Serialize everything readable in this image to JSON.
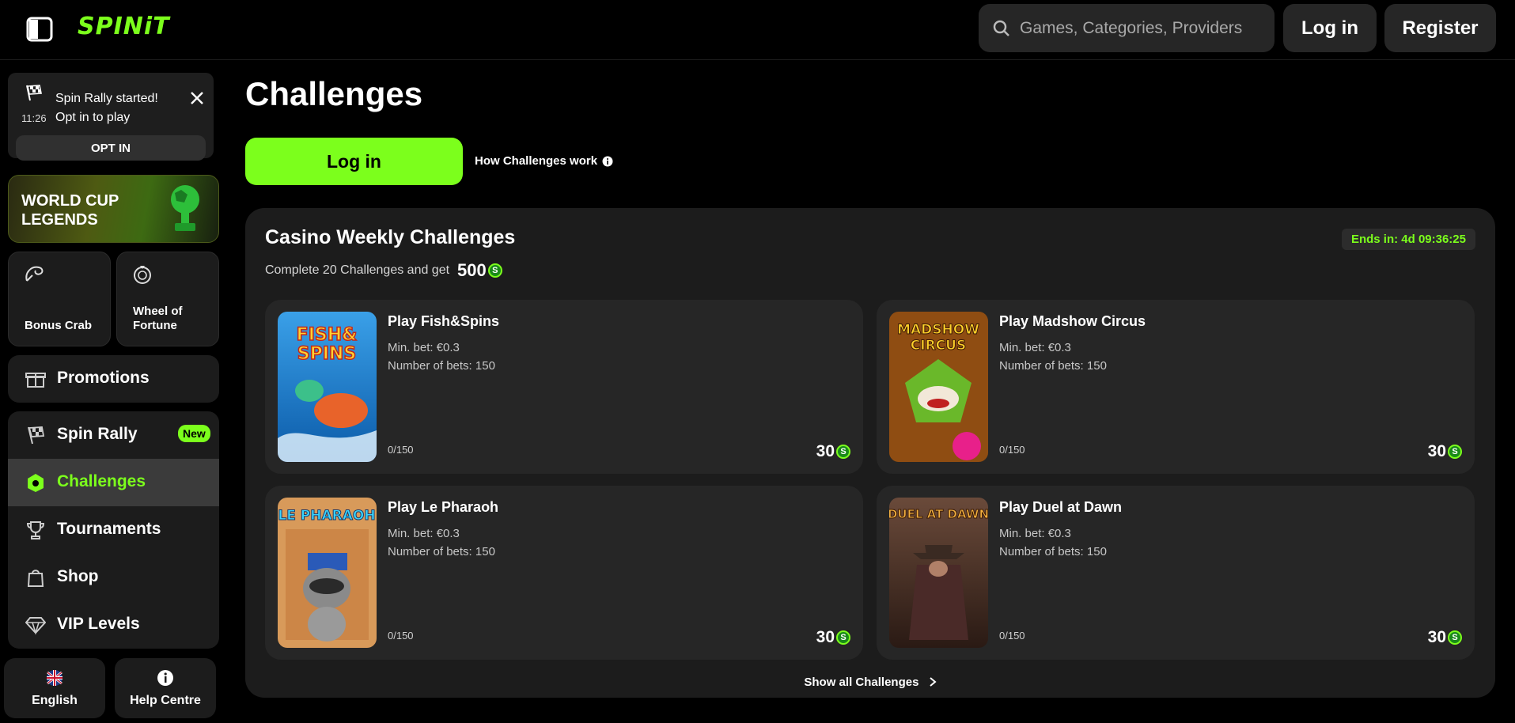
{
  "header": {
    "logo": "SPINiT",
    "search_placeholder": "Games, Categories, Providers",
    "login_label": "Log in",
    "register_label": "Register"
  },
  "sidebar": {
    "notice": {
      "time": "11:26",
      "title": "Spin Rally started!",
      "subtitle": "Opt in to play",
      "optin_label": "OPT IN"
    },
    "world_cup": "WORLD CUP LEGENDS",
    "tiles": [
      {
        "label": "Bonus Crab"
      },
      {
        "label": "Wheel of Fortune"
      }
    ],
    "promotions": "Promotions",
    "nav": [
      {
        "label": "Spin Rally",
        "badge": "New"
      },
      {
        "label": "Challenges"
      },
      {
        "label": "Tournaments"
      },
      {
        "label": "Shop"
      },
      {
        "label": "VIP Levels"
      }
    ],
    "language": "English",
    "help": "Help Centre"
  },
  "main": {
    "title": "Challenges",
    "login_label": "Log in",
    "how_label": "How Challenges work",
    "panel": {
      "title": "Casino Weekly Challenges",
      "subtitle": "Complete 20 Challenges and get",
      "amount": "500",
      "ends": "Ends in: 4d 09:36:25",
      "show_all": "Show all Challenges",
      "cards": [
        {
          "title": "Play Fish&Spins",
          "min_bet": "Min. bet: €0.3",
          "bets": "Number of bets: 150",
          "progress": "0/150",
          "reward": "30"
        },
        {
          "title": "Play Madshow Circus",
          "min_bet": "Min. bet: €0.3",
          "bets": "Number of bets: 150",
          "progress": "0/150",
          "reward": "30"
        },
        {
          "title": "Play Le Pharaoh",
          "min_bet": "Min. bet: €0.3",
          "bets": "Number of bets: 150",
          "progress": "0/150",
          "reward": "30"
        },
        {
          "title": "Play Duel at Dawn",
          "min_bet": "Min. bet: €0.3",
          "bets": "Number of bets: 150",
          "progress": "0/150",
          "reward": "30"
        }
      ]
    }
  },
  "colors": {
    "accent": "#7cff1c",
    "panel": "#1c1c1c",
    "card": "#262626"
  }
}
